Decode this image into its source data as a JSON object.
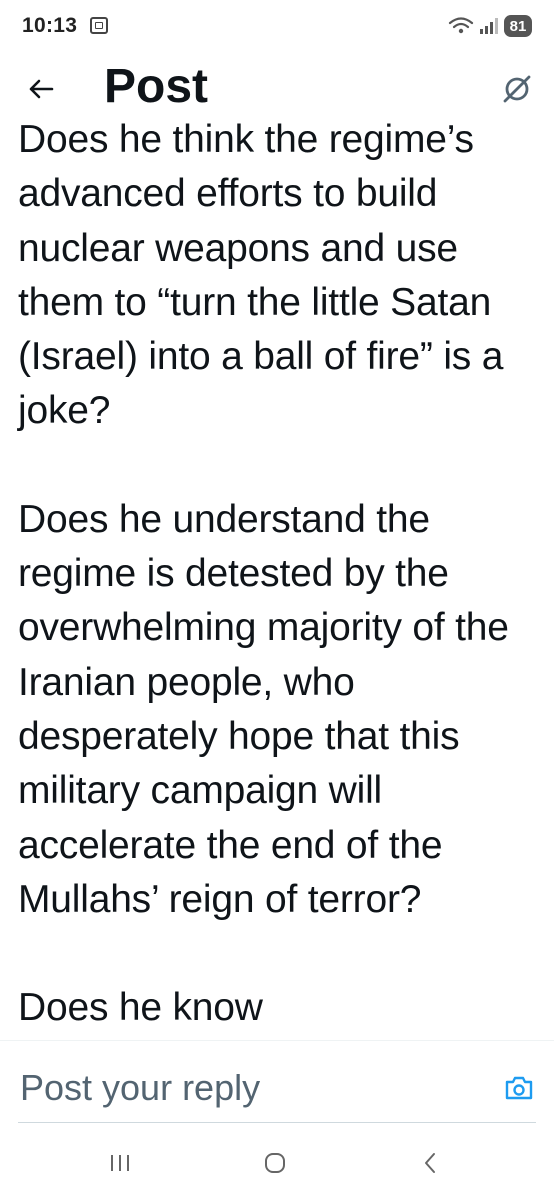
{
  "status_bar": {
    "time": "10:13",
    "battery": "81",
    "icons": [
      "screenshot-icon",
      "wifi-icon",
      "signal-icon",
      "battery-icon"
    ]
  },
  "header": {
    "back_icon": "back-arrow-icon",
    "title": "Post",
    "grok_icon": "grok-icon"
  },
  "post": {
    "paragraphs": [
      "Does he think the regime’s advanced efforts to build nuclear weapons and use them to “turn the little Satan (Israel) into a ball of fire” is a joke?",
      "Does he understand the regime is detested by the overwhelming majority of the Iranian people, who desperately hope that this military campaign will accelerate the end of the Mullahs’ reign of terror?",
      "Does he know"
    ]
  },
  "reply": {
    "placeholder": "Post your reply",
    "camera_icon": "camera-icon"
  },
  "nav_bar": {
    "icons": [
      "recents-icon",
      "home-icon",
      "back-icon"
    ]
  },
  "colors": {
    "text": "#0f1419",
    "secondary_text": "#536471",
    "accent": "#1d9bf0",
    "background": "#ffffff"
  }
}
